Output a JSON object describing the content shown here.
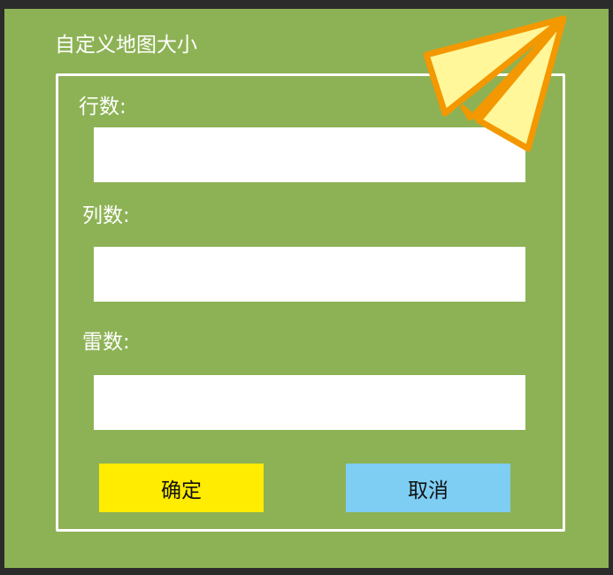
{
  "dialog": {
    "title": "自定义地图大小",
    "fields": [
      {
        "label": "行数:",
        "value": ""
      },
      {
        "label": "列数:",
        "value": ""
      },
      {
        "label": "雷数:",
        "value": ""
      }
    ],
    "buttons": {
      "confirm": "确定",
      "cancel": "取消"
    },
    "decoration_icon": "paper-plane-icon"
  },
  "colors": {
    "panel": "#8db255",
    "confirm_button": "#ffec00",
    "cancel_button": "#7ecef4",
    "plane_outline": "#f39800",
    "plane_fill": "#fff799"
  }
}
